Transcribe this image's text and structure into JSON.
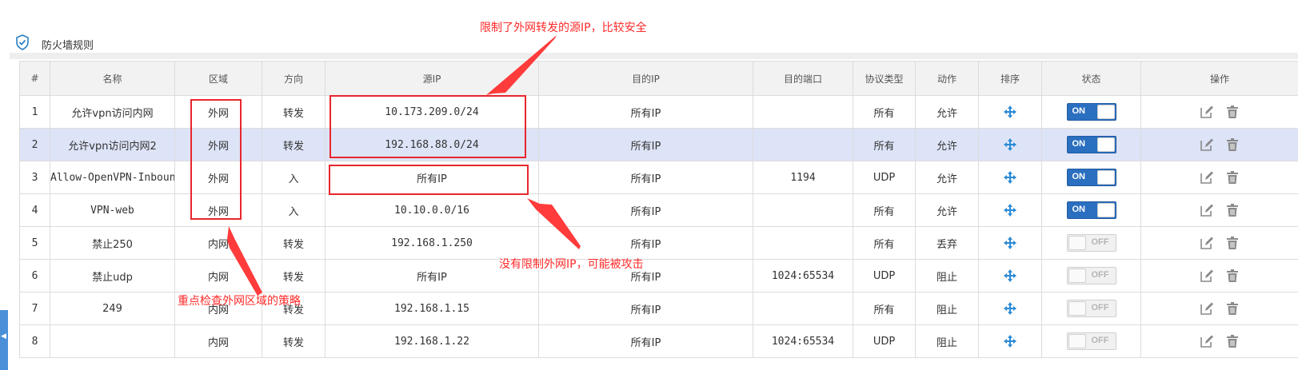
{
  "page_title": "防火墙规则",
  "columns": [
    "#",
    "名称",
    "区域",
    "方向",
    "源IP",
    "目的IP",
    "目的端口",
    "协议类型",
    "动作",
    "排序",
    "状态",
    "操作"
  ],
  "rows": [
    {
      "no": "1",
      "name": "允许vpn访问内网",
      "zone": "外网",
      "direction": "转发",
      "src": "10.173.209.0/24",
      "dst": "所有IP",
      "port": "",
      "proto": "所有",
      "action": "允许",
      "status": "ON",
      "on": true
    },
    {
      "no": "2",
      "name": "允许vpn访问内网2",
      "zone": "外网",
      "direction": "转发",
      "src": "192.168.88.0/24",
      "dst": "所有IP",
      "port": "",
      "proto": "所有",
      "action": "允许",
      "status": "ON",
      "on": true
    },
    {
      "no": "3",
      "name": "Allow-OpenVPN-Inbound",
      "zone": "外网",
      "direction": "入",
      "src": "所有IP",
      "dst": "所有IP",
      "port": "1194",
      "proto": "UDP",
      "action": "允许",
      "status": "ON",
      "on": true
    },
    {
      "no": "4",
      "name": "VPN-web",
      "zone": "外网",
      "direction": "入",
      "src": "10.10.0.0/16",
      "dst": "所有IP",
      "port": "",
      "proto": "所有",
      "action": "允许",
      "status": "ON",
      "on": true
    },
    {
      "no": "5",
      "name": "禁止250",
      "zone": "内网",
      "direction": "转发",
      "src": "192.168.1.250",
      "dst": "所有IP",
      "port": "",
      "proto": "所有",
      "action": "丢弃",
      "status": "OFF",
      "on": false
    },
    {
      "no": "6",
      "name": "禁止udp",
      "zone": "内网",
      "direction": "转发",
      "src": "所有IP",
      "dst": "所有IP",
      "port": "1024:65534",
      "proto": "UDP",
      "action": "阻止",
      "status": "OFF",
      "on": false
    },
    {
      "no": "7",
      "name": "249",
      "zone": "内网",
      "direction": "转发",
      "src": "192.168.1.15",
      "dst": "所有IP",
      "port": "",
      "proto": "所有",
      "action": "阻止",
      "status": "OFF",
      "on": false
    },
    {
      "no": "8",
      "name": "",
      "zone": "内网",
      "direction": "转发",
      "src": "192.168.1.22",
      "dst": "所有IP",
      "port": "1024:65534",
      "proto": "UDP",
      "action": "阻止",
      "status": "OFF",
      "on": false
    }
  ],
  "annotations": {
    "top": "限制了外网转发的源IP，比较安全",
    "middle": "没有限制外网IP，可能被攻击",
    "left": "重点检查外网区域的策略"
  },
  "icons": {
    "title": "shield-check-icon",
    "sort": "move-arrows-icon",
    "edit": "edit-icon",
    "delete": "trash-icon"
  },
  "colors": {
    "toggle_on": "#2a6fc0",
    "annotation": "#e8262c",
    "row_highlight": "#dde4f7"
  }
}
